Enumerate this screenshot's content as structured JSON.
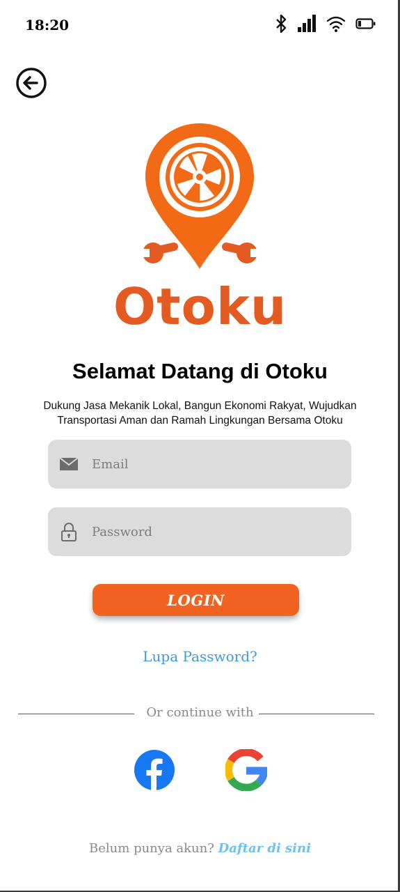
{
  "status_bar": {
    "time": "18:20",
    "icons": [
      "bluetooth-icon",
      "signal-icon",
      "wifi-icon",
      "battery-icon"
    ]
  },
  "back_icon": "arrow-left-circle-icon",
  "logo": {
    "text": "Otoku",
    "color": "#e45b21",
    "icon": "map-pin-wheel-wrench-icon"
  },
  "welcome": {
    "title": "Selamat Datang di Otoku",
    "subtitle": "Dukung Jasa Mekanik Lokal, Bangun Ekonomi Rakyat, Wujudkan Transportasi Aman dan Ramah Lingkungan Bersama Otoku"
  },
  "form": {
    "email": {
      "placeholder": "Email",
      "value": "",
      "icon": "envelope-icon"
    },
    "password": {
      "placeholder": "Password",
      "value": "",
      "icon": "lock-icon"
    },
    "login_label": "LOGIN",
    "forgot_label": "Lupa Password?"
  },
  "divider_text": "Or continue with",
  "social": [
    {
      "name": "facebook",
      "icon": "facebook-icon"
    },
    {
      "name": "google",
      "icon": "google-icon"
    }
  ],
  "signup": {
    "prompt": "Belum punya akun?",
    "link": "Daftar di sini"
  },
  "colors": {
    "accent": "#f26322",
    "link": "#3b9be0",
    "field_bg": "#dcdcdc"
  }
}
